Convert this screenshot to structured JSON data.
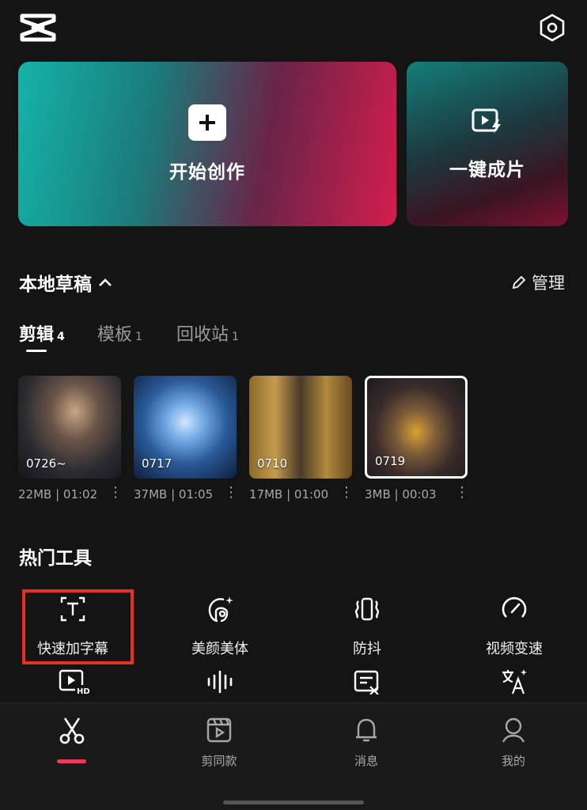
{
  "header": {
    "logo_icon": "capcut-logo-icon",
    "settings_icon": "settings-icon"
  },
  "cards": {
    "start_label": "开始创作",
    "oneclick_label": "一键成片"
  },
  "drafts": {
    "title": "本地草稿",
    "manage_label": "管理",
    "tabs": [
      {
        "label": "剪辑",
        "count": "4"
      },
      {
        "label": "模板",
        "count": "1"
      },
      {
        "label": "回收站",
        "count": "1"
      }
    ],
    "items": [
      {
        "label": "0726~",
        "meta": "22MB | 01:02"
      },
      {
        "label": "0717",
        "meta": "37MB | 01:05"
      },
      {
        "label": "0710",
        "meta": "17MB | 01:00"
      },
      {
        "label": "0719",
        "meta": "3MB | 00:03"
      }
    ]
  },
  "tools": {
    "title": "热门工具",
    "items": [
      {
        "label": "快速加字幕",
        "icon": "text-caption-icon"
      },
      {
        "label": "美颜美体",
        "icon": "beauty-icon"
      },
      {
        "label": "防抖",
        "icon": "stabilize-icon"
      },
      {
        "label": "视频变速",
        "icon": "speed-gauge-icon"
      }
    ],
    "second_row_icons": [
      "hd-video-icon",
      "audio-wave-icon",
      "subtitle-edit-icon",
      "translate-icon"
    ]
  },
  "bottom_nav": {
    "items": [
      {
        "label": "",
        "icon": "scissors-icon",
        "active": true
      },
      {
        "label": "剪同款",
        "icon": "template-film-icon"
      },
      {
        "label": "消息",
        "icon": "bell-icon"
      },
      {
        "label": "我的",
        "icon": "profile-icon"
      }
    ]
  },
  "colors": {
    "background": "#141414",
    "accent_red": "#ee3a5a",
    "highlight_box": "#e8321f"
  }
}
